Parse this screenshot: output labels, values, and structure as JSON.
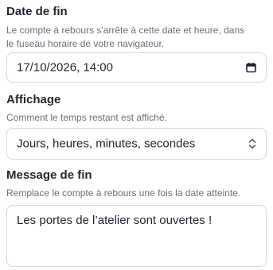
{
  "end_date": {
    "label": "Date de fin",
    "help": "Le compte à rebours s'arrête à cette date et heure, dans le fuseau horaire de votre navigateur.",
    "value": "17/10/2026, 14:00",
    "icon": "calendar-icon"
  },
  "display": {
    "label": "Affichage",
    "help": "Comment le temps restant est affiché.",
    "selected": "Jours, heures, minutes, secondes",
    "icon": "chevron-up-down-icon"
  },
  "end_message": {
    "label": "Message de fin",
    "help": "Remplace le compte à rebours une fois la date atteinte.",
    "value": "Les portes de l’atelier sont ouvertes !"
  }
}
